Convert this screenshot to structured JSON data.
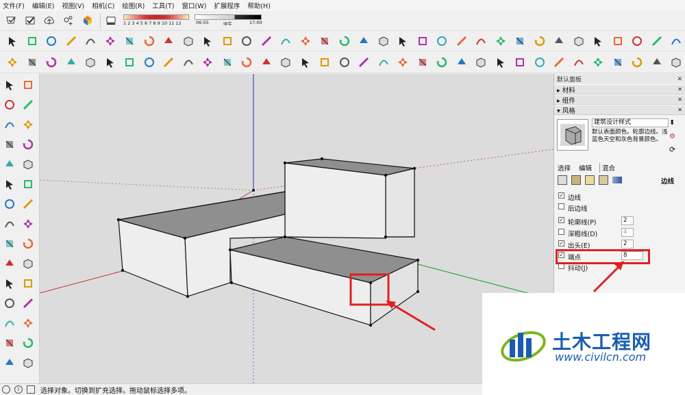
{
  "menu": [
    "文件(F)",
    "编辑(E)",
    "视图(V)",
    "相机(C)",
    "绘图(R)",
    "工具(T)",
    "窗口(W)",
    "扩展程序",
    "帮助(H)"
  ],
  "shadow": {
    "months": "1 2 3 4 5 6 7 8 9 10 11 12",
    "time_start": "06:55",
    "time_mid": "中午",
    "time_end": "17:00"
  },
  "tray": {
    "title": "默认面板",
    "sections": [
      "材料",
      "组件",
      "风格"
    ],
    "style_name": "建筑设计样式",
    "style_desc": "默认表面颜色。轮廓边线。浅蓝色天空和灰色背景颜色。",
    "tabs": [
      "选择",
      "编辑",
      "混合"
    ],
    "edit_heading": "边线",
    "options": [
      {
        "label": "边线",
        "checked": true,
        "value": ""
      },
      {
        "label": "后边线",
        "checked": false,
        "value": ""
      },
      {
        "label": "轮廓线(P)",
        "checked": true,
        "value": "2"
      },
      {
        "label": "深粗线(D)",
        "checked": false,
        "value": "4"
      },
      {
        "label": "出头(E)",
        "checked": true,
        "value": "2"
      },
      {
        "label": "端点",
        "checked": true,
        "value": "8"
      },
      {
        "label": "抖动(J)",
        "checked": false,
        "value": ""
      }
    ]
  },
  "status": {
    "text": "选择对象。切换到扩充选择。拖动鼠标选择多项。"
  },
  "watermark": {
    "brand": "土木工程网",
    "url": "www.civilcn.com"
  },
  "colors": {
    "highlight": "#e02020",
    "axis_blue": "#2030c0",
    "axis_red": "#c03030",
    "axis_green": "#20a020",
    "top_face": "#8f8f8f",
    "side_face": "#eeeeee",
    "viewport_bg": "#dcdcdc",
    "logo_blue": "#1a5db0",
    "logo_green": "#7ab51d"
  }
}
